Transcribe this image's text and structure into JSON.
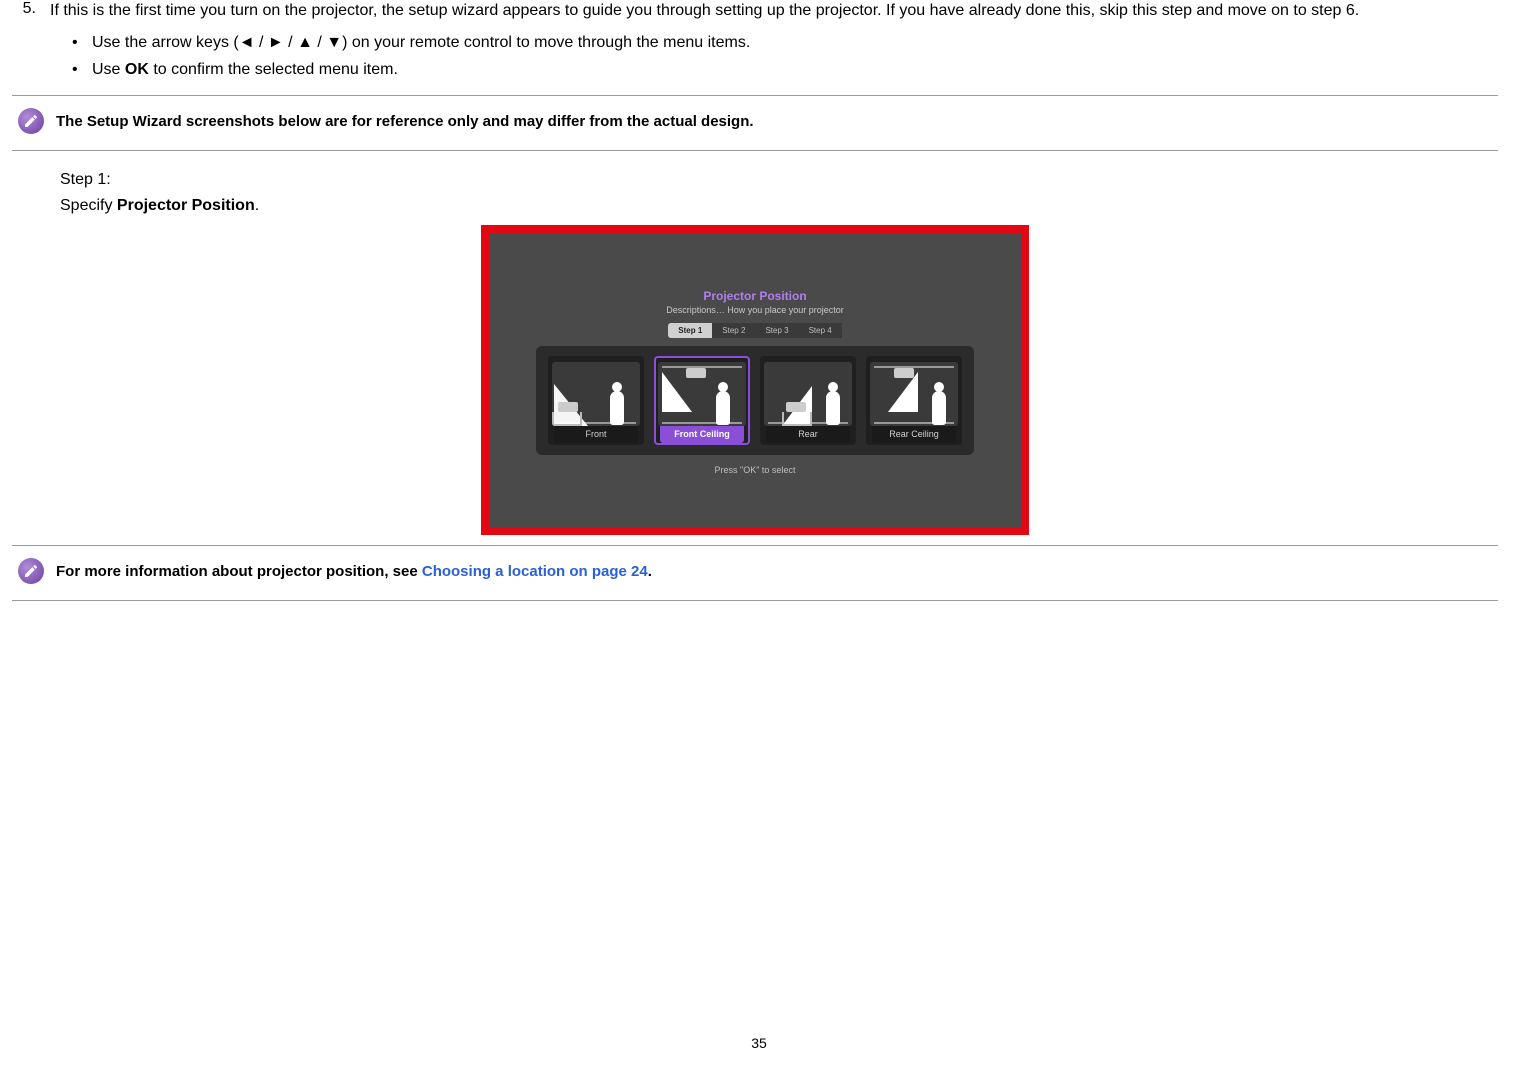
{
  "step5": {
    "number": "5.",
    "text_a": "If this is the first time you turn on the projector, the setup wizard appears to guide you through setting up the projector. If you have already done this, skip this step and move on to step 6.",
    "bullet1_a": "Use the arrow keys (",
    "bullet1_arrows": "◄ / ► / ▲ / ▼",
    "bullet1_b": ") on your remote control to move through the menu items.",
    "bullet2_a": "Use ",
    "bullet2_bold": "OK",
    "bullet2_b": " to confirm the selected menu item."
  },
  "note1": {
    "text": "The Setup Wizard screenshots below are for reference only and may differ from the actual design."
  },
  "step1": {
    "label": "Step 1:",
    "desc_a": "Specify ",
    "desc_bold": "Projector Position",
    "desc_b": "."
  },
  "screenshot": {
    "title": "Projector Position",
    "desc": "Descriptions… How you place your projector",
    "tabs": [
      "Step 1",
      "Step 2",
      "Step 3",
      "Step 4"
    ],
    "active_tab": 0,
    "cards": [
      {
        "label": "Front",
        "selected": false
      },
      {
        "label": "Front Ceiling",
        "selected": true
      },
      {
        "label": "Rear",
        "selected": false
      },
      {
        "label": "Rear Ceiling",
        "selected": false
      }
    ],
    "hint": "Press \"OK\" to select"
  },
  "note2": {
    "text_a": "For more information about projector position, see ",
    "link": "Choosing a location on page 24",
    "text_b": "."
  },
  "page_number": "35"
}
